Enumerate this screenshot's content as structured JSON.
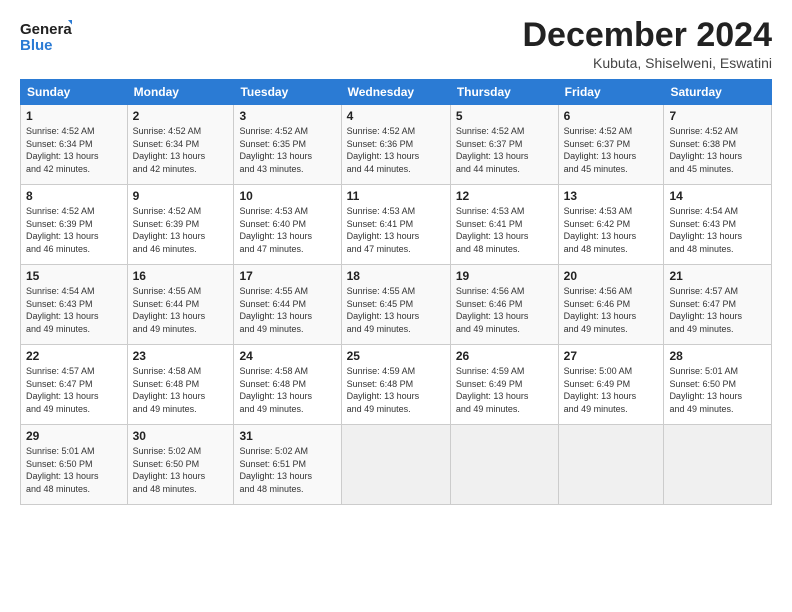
{
  "logo": {
    "line1": "General",
    "line2": "Blue"
  },
  "header": {
    "month": "December 2024",
    "location": "Kubuta, Shiselweni, Eswatini"
  },
  "weekdays": [
    "Sunday",
    "Monday",
    "Tuesday",
    "Wednesday",
    "Thursday",
    "Friday",
    "Saturday"
  ],
  "weeks": [
    [
      {
        "day": "1",
        "detail": "Sunrise: 4:52 AM\nSunset: 6:34 PM\nDaylight: 13 hours\nand 42 minutes."
      },
      {
        "day": "2",
        "detail": "Sunrise: 4:52 AM\nSunset: 6:34 PM\nDaylight: 13 hours\nand 42 minutes."
      },
      {
        "day": "3",
        "detail": "Sunrise: 4:52 AM\nSunset: 6:35 PM\nDaylight: 13 hours\nand 43 minutes."
      },
      {
        "day": "4",
        "detail": "Sunrise: 4:52 AM\nSunset: 6:36 PM\nDaylight: 13 hours\nand 44 minutes."
      },
      {
        "day": "5",
        "detail": "Sunrise: 4:52 AM\nSunset: 6:37 PM\nDaylight: 13 hours\nand 44 minutes."
      },
      {
        "day": "6",
        "detail": "Sunrise: 4:52 AM\nSunset: 6:37 PM\nDaylight: 13 hours\nand 45 minutes."
      },
      {
        "day": "7",
        "detail": "Sunrise: 4:52 AM\nSunset: 6:38 PM\nDaylight: 13 hours\nand 45 minutes."
      }
    ],
    [
      {
        "day": "8",
        "detail": "Sunrise: 4:52 AM\nSunset: 6:39 PM\nDaylight: 13 hours\nand 46 minutes."
      },
      {
        "day": "9",
        "detail": "Sunrise: 4:52 AM\nSunset: 6:39 PM\nDaylight: 13 hours\nand 46 minutes."
      },
      {
        "day": "10",
        "detail": "Sunrise: 4:53 AM\nSunset: 6:40 PM\nDaylight: 13 hours\nand 47 minutes."
      },
      {
        "day": "11",
        "detail": "Sunrise: 4:53 AM\nSunset: 6:41 PM\nDaylight: 13 hours\nand 47 minutes."
      },
      {
        "day": "12",
        "detail": "Sunrise: 4:53 AM\nSunset: 6:41 PM\nDaylight: 13 hours\nand 48 minutes."
      },
      {
        "day": "13",
        "detail": "Sunrise: 4:53 AM\nSunset: 6:42 PM\nDaylight: 13 hours\nand 48 minutes."
      },
      {
        "day": "14",
        "detail": "Sunrise: 4:54 AM\nSunset: 6:43 PM\nDaylight: 13 hours\nand 48 minutes."
      }
    ],
    [
      {
        "day": "15",
        "detail": "Sunrise: 4:54 AM\nSunset: 6:43 PM\nDaylight: 13 hours\nand 49 minutes."
      },
      {
        "day": "16",
        "detail": "Sunrise: 4:55 AM\nSunset: 6:44 PM\nDaylight: 13 hours\nand 49 minutes."
      },
      {
        "day": "17",
        "detail": "Sunrise: 4:55 AM\nSunset: 6:44 PM\nDaylight: 13 hours\nand 49 minutes."
      },
      {
        "day": "18",
        "detail": "Sunrise: 4:55 AM\nSunset: 6:45 PM\nDaylight: 13 hours\nand 49 minutes."
      },
      {
        "day": "19",
        "detail": "Sunrise: 4:56 AM\nSunset: 6:46 PM\nDaylight: 13 hours\nand 49 minutes."
      },
      {
        "day": "20",
        "detail": "Sunrise: 4:56 AM\nSunset: 6:46 PM\nDaylight: 13 hours\nand 49 minutes."
      },
      {
        "day": "21",
        "detail": "Sunrise: 4:57 AM\nSunset: 6:47 PM\nDaylight: 13 hours\nand 49 minutes."
      }
    ],
    [
      {
        "day": "22",
        "detail": "Sunrise: 4:57 AM\nSunset: 6:47 PM\nDaylight: 13 hours\nand 49 minutes."
      },
      {
        "day": "23",
        "detail": "Sunrise: 4:58 AM\nSunset: 6:48 PM\nDaylight: 13 hours\nand 49 minutes."
      },
      {
        "day": "24",
        "detail": "Sunrise: 4:58 AM\nSunset: 6:48 PM\nDaylight: 13 hours\nand 49 minutes."
      },
      {
        "day": "25",
        "detail": "Sunrise: 4:59 AM\nSunset: 6:48 PM\nDaylight: 13 hours\nand 49 minutes."
      },
      {
        "day": "26",
        "detail": "Sunrise: 4:59 AM\nSunset: 6:49 PM\nDaylight: 13 hours\nand 49 minutes."
      },
      {
        "day": "27",
        "detail": "Sunrise: 5:00 AM\nSunset: 6:49 PM\nDaylight: 13 hours\nand 49 minutes."
      },
      {
        "day": "28",
        "detail": "Sunrise: 5:01 AM\nSunset: 6:50 PM\nDaylight: 13 hours\nand 49 minutes."
      }
    ],
    [
      {
        "day": "29",
        "detail": "Sunrise: 5:01 AM\nSunset: 6:50 PM\nDaylight: 13 hours\nand 48 minutes."
      },
      {
        "day": "30",
        "detail": "Sunrise: 5:02 AM\nSunset: 6:50 PM\nDaylight: 13 hours\nand 48 minutes."
      },
      {
        "day": "31",
        "detail": "Sunrise: 5:02 AM\nSunset: 6:51 PM\nDaylight: 13 hours\nand 48 minutes."
      },
      {
        "day": "",
        "detail": ""
      },
      {
        "day": "",
        "detail": ""
      },
      {
        "day": "",
        "detail": ""
      },
      {
        "day": "",
        "detail": ""
      }
    ]
  ]
}
